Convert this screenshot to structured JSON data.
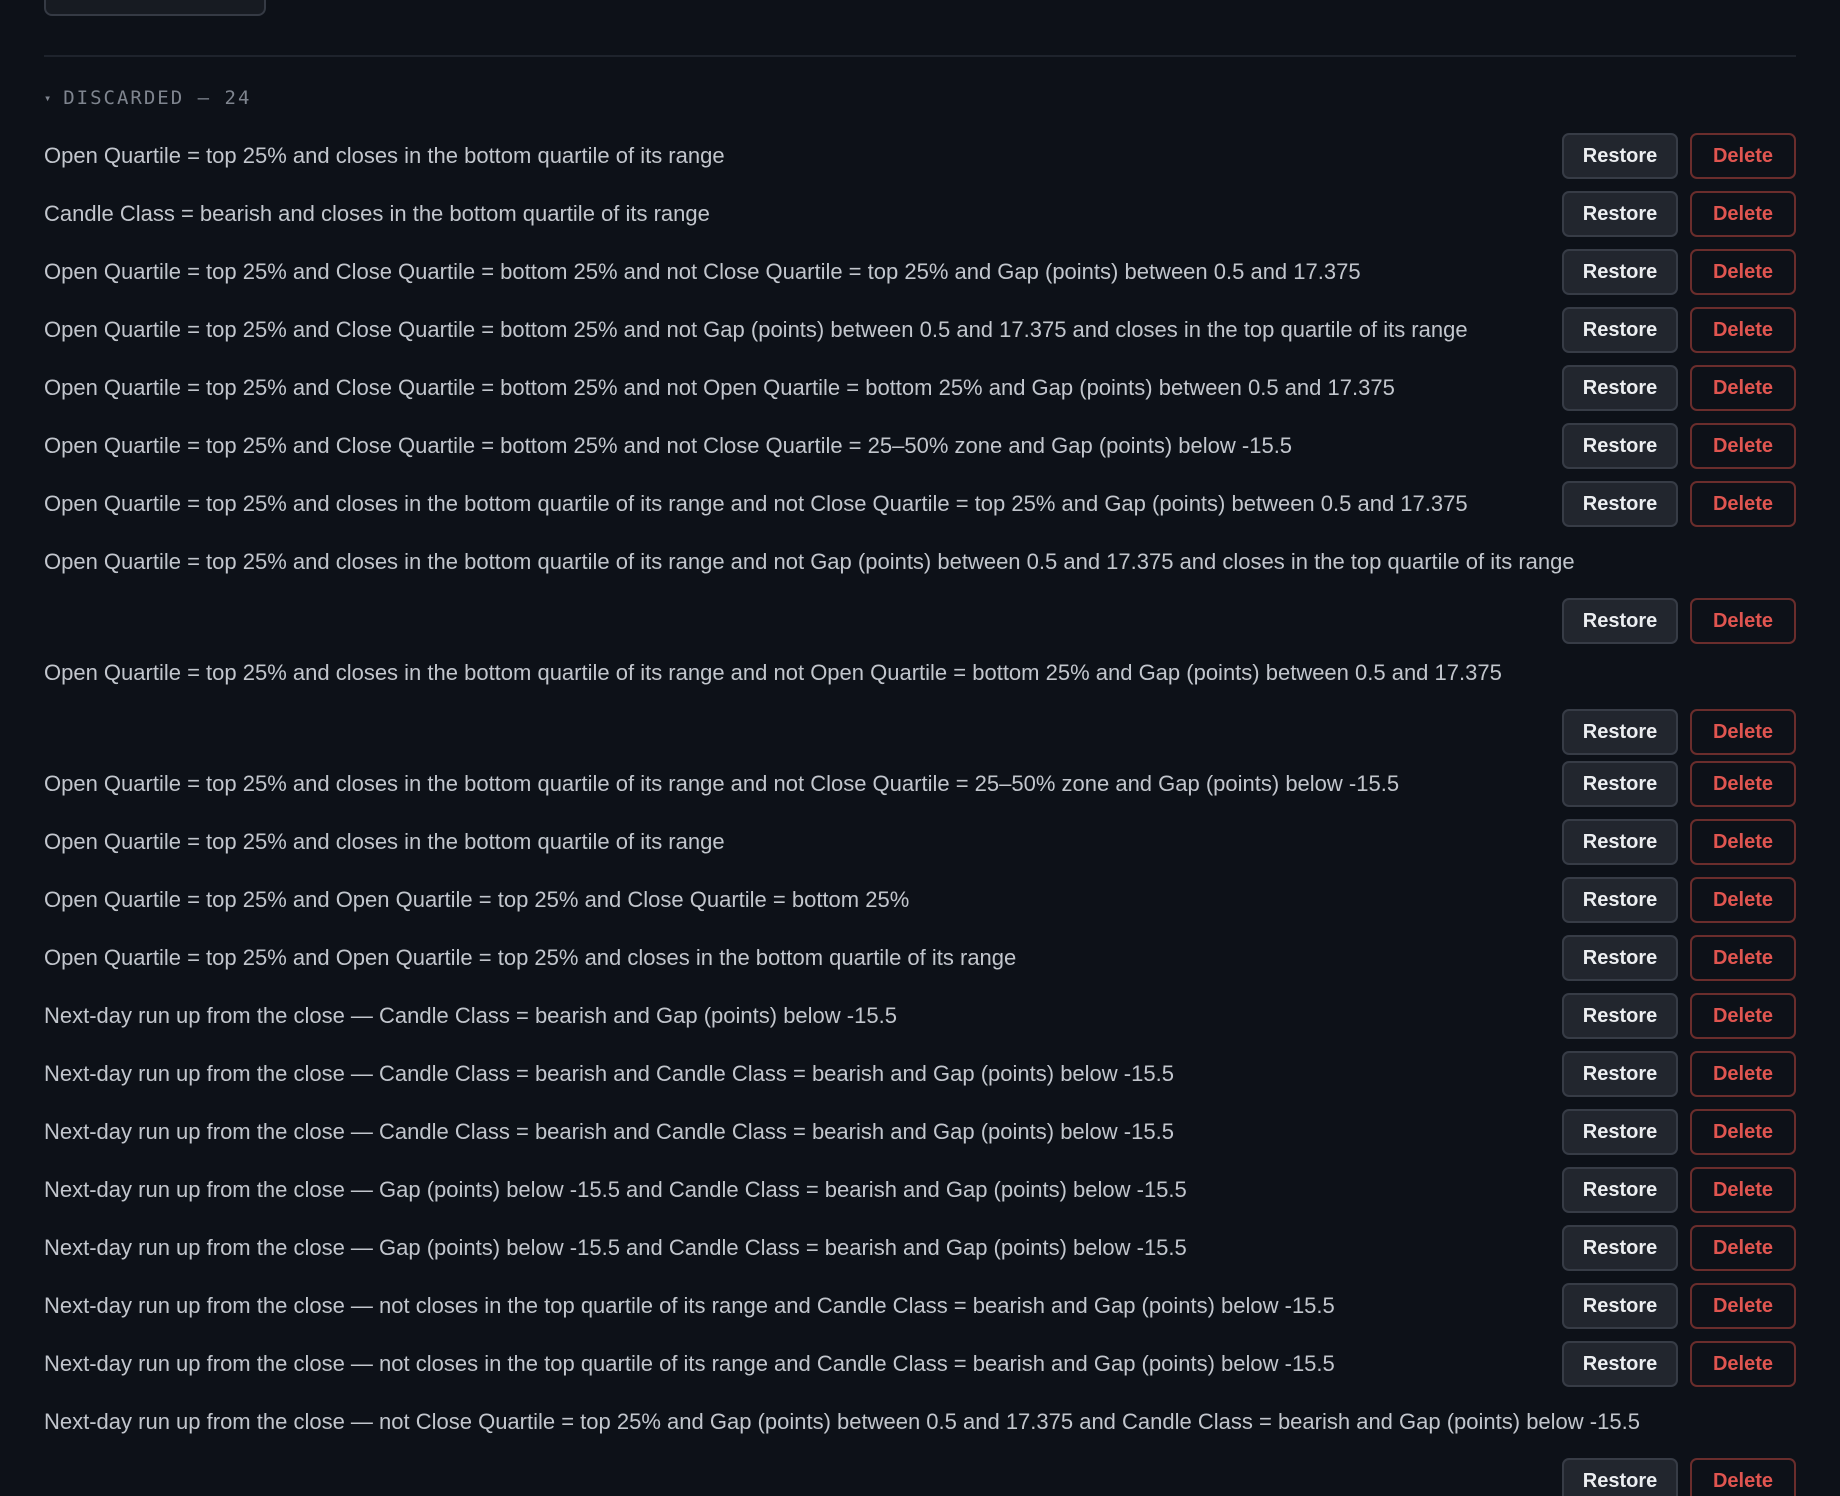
{
  "top_button": {
    "label": ""
  },
  "section": {
    "caret": "▾",
    "title": "DISCARDED — 24"
  },
  "labels": {
    "restore": "Restore",
    "delete": "Delete"
  },
  "items": [
    {
      "text": "Open Quartile = top 25% and closes in the bottom quartile of its range"
    },
    {
      "text": "Candle Class = bearish and closes in the bottom quartile of its range"
    },
    {
      "text": "Open Quartile = top 25% and Close Quartile = bottom 25% and not Close Quartile = top 25% and Gap (points) between 0.5 and 17.375"
    },
    {
      "text": "Open Quartile = top 25% and Close Quartile = bottom 25% and not Gap (points) between 0.5 and 17.375 and closes in the top quartile of its range"
    },
    {
      "text": "Open Quartile = top 25% and Close Quartile = bottom 25% and not Open Quartile = bottom 25% and Gap (points) between 0.5 and 17.375"
    },
    {
      "text": "Open Quartile = top 25% and Close Quartile = bottom 25% and not Close Quartile = 25–50% zone and Gap (points) below -15.5"
    },
    {
      "text": "Open Quartile = top 25% and closes in the bottom quartile of its range and not Close Quartile = top 25% and Gap (points) between 0.5 and 17.375"
    },
    {
      "text": "Open Quartile = top 25% and closes in the bottom quartile of its range and not Gap (points) between 0.5 and 17.375 and closes in the top quartile of its range",
      "wrapped": true
    },
    {
      "text": "Open Quartile = top 25% and closes in the bottom quartile of its range and not Open Quartile = bottom 25% and Gap (points) between 0.5 and 17.375",
      "wrapped": true
    },
    {
      "text": "Open Quartile = top 25% and closes in the bottom quartile of its range and not Close Quartile = 25–50% zone and Gap (points) below -15.5"
    },
    {
      "text": "Open Quartile = top 25% and closes in the bottom quartile of its range"
    },
    {
      "text": "Open Quartile = top 25% and Open Quartile = top 25% and Close Quartile = bottom 25%"
    },
    {
      "text": "Open Quartile = top 25% and Open Quartile = top 25% and closes in the bottom quartile of its range"
    },
    {
      "text": "Next-day run up from the close — Candle Class = bearish and Gap (points) below -15.5"
    },
    {
      "text": "Next-day run up from the close — Candle Class = bearish and Candle Class = bearish and Gap (points) below -15.5"
    },
    {
      "text": "Next-day run up from the close — Candle Class = bearish and Candle Class = bearish and Gap (points) below -15.5"
    },
    {
      "text": "Next-day run up from the close — Gap (points) below -15.5 and Candle Class = bearish and Gap (points) below -15.5"
    },
    {
      "text": "Next-day run up from the close — Gap (points) below -15.5 and Candle Class = bearish and Gap (points) below -15.5"
    },
    {
      "text": "Next-day run up from the close — not closes in the top quartile of its range and Candle Class = bearish and Gap (points) below -15.5"
    },
    {
      "text": "Next-day run up from the close — not closes in the top quartile of its range and Candle Class = bearish and Gap (points) below -15.5"
    },
    {
      "text": "Next-day run up from the close — not Close Quartile = top 25% and Gap (points) between 0.5 and 17.375 and Candle Class = bearish and Gap (points) below -15.5",
      "wrapped": true
    }
  ]
}
